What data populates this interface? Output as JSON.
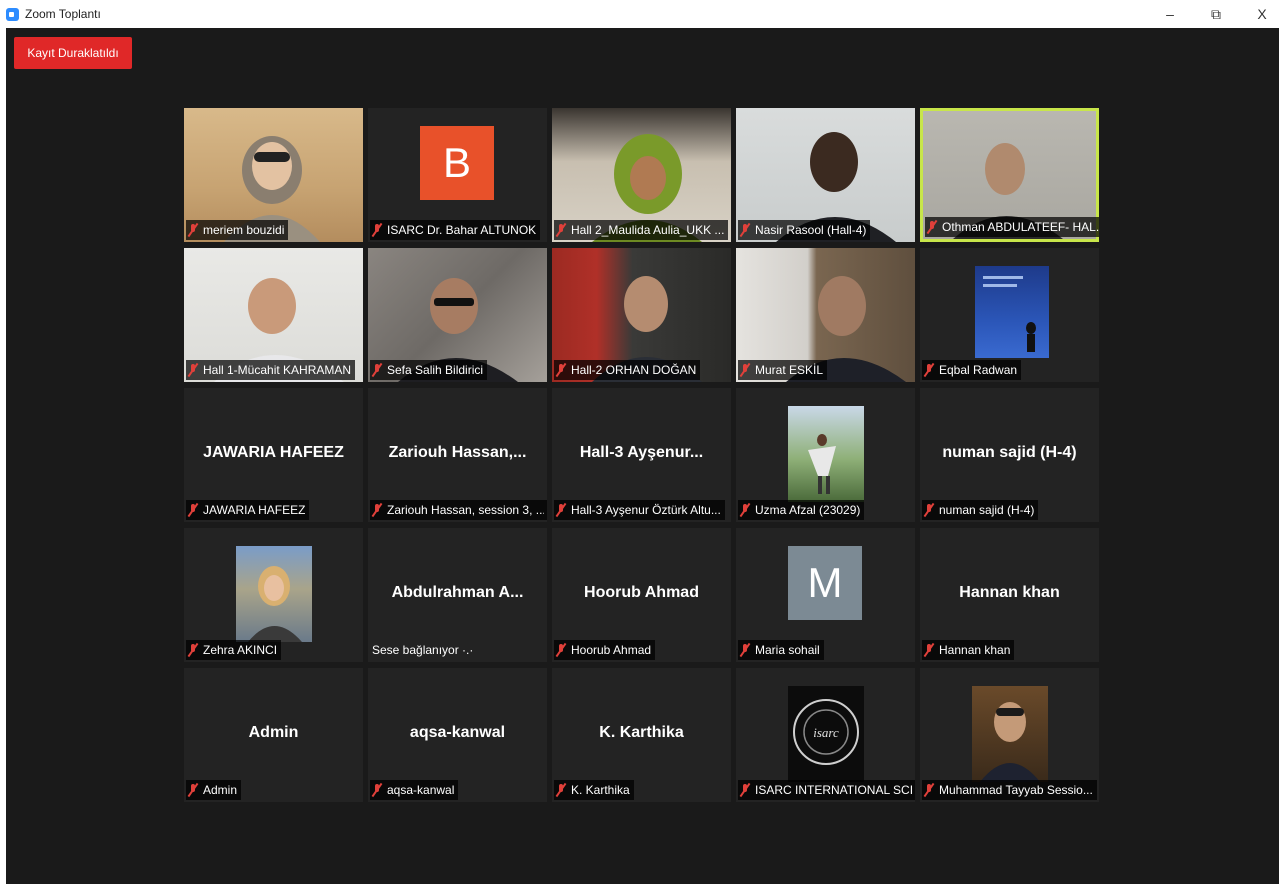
{
  "window": {
    "title": "Zoom Toplantı",
    "minimize": "–",
    "restore": "⧉",
    "close": "X"
  },
  "recording_badge": "Kayıt Duraklatıldı",
  "tiles": [
    {
      "name": "meriem bouzidi",
      "muted": true
    },
    {
      "name": "ISARC Dr. Bahar ALTUNOK",
      "muted": true,
      "avatar_letter": "B"
    },
    {
      "name": "Hall 2_Maulida Aulia_UKK ...",
      "muted": true
    },
    {
      "name": "Nasir Rasool (Hall-4)",
      "muted": true
    },
    {
      "name": "Othman ABDULATEEF- HAL...",
      "muted": true,
      "active_speaker": true
    },
    {
      "name": "Hall 1-Mücahit KAHRAMAN",
      "muted": true
    },
    {
      "name": "Sefa Salih Bildirici",
      "muted": true
    },
    {
      "name": "Hall-2 ORHAN DOĞAN",
      "muted": true
    },
    {
      "name": "Murat ESKİL",
      "muted": true
    },
    {
      "name": "Eqbal Radwan",
      "muted": true
    },
    {
      "display": "JAWARIA HAFEEZ",
      "name": "JAWARIA HAFEEZ",
      "muted": true
    },
    {
      "display": "Zariouh  Hassan,...",
      "name": "Zariouh Hassan, session 3, ...",
      "muted": true
    },
    {
      "display": "Hall-3  Ayşenur...",
      "name": "Hall-3 Ayşenur Öztürk Altu...",
      "muted": true
    },
    {
      "name": "Uzma Afzal (23029)",
      "muted": true
    },
    {
      "display": "numan sajid (H-4)",
      "name": "numan sajid (H-4)",
      "muted": true
    },
    {
      "name": "Zehra AKINCI",
      "muted": true
    },
    {
      "display": "Abdulrahman  A...",
      "name": "Sese bağlanıyor ·.·",
      "muted": false
    },
    {
      "display": "Hoorub Ahmad",
      "name": "Hoorub Ahmad",
      "muted": true
    },
    {
      "name": "Maria sohail",
      "muted": true,
      "avatar_letter": "M"
    },
    {
      "display": "Hannan khan",
      "name": "Hannan khan",
      "muted": true
    },
    {
      "display": "Admin",
      "name": "Admin",
      "muted": true
    },
    {
      "display": "aqsa-kanwal",
      "name": "aqsa-kanwal",
      "muted": true
    },
    {
      "display": "K. Karthika",
      "name": "K. Karthika",
      "muted": true
    },
    {
      "name": "ISARC INTERNATIONAL SCI...",
      "muted": true,
      "logo_text": "isarc"
    },
    {
      "name": "Muhammad Tayyab Sessio...",
      "muted": true
    }
  ],
  "colors": {
    "stage": "#1a1a1a",
    "tile": "#232323",
    "record": "#e02828",
    "active_border": "#c8e64a",
    "muted_mic": "#e0403a"
  }
}
